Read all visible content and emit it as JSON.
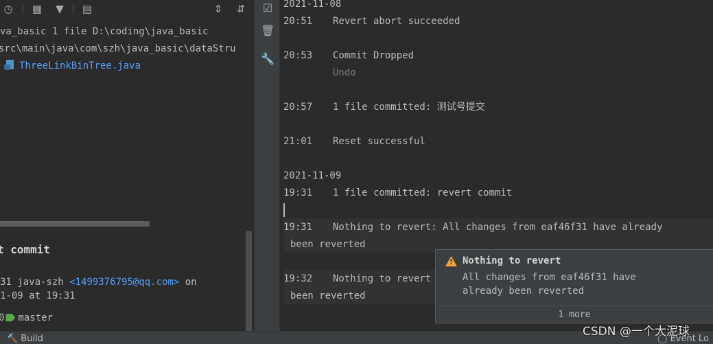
{
  "left_panel": {
    "toolbar_icons": [
      "history-icon",
      "group-by-icon",
      "filter-icon",
      "layout-icon",
      "expand-all-icon",
      "collapse-all-icon"
    ],
    "tree": {
      "root_row": "va_basic  1 file  D:\\coding\\java_basic",
      "path_row": "src\\main\\java\\com\\szh\\java_basic\\dataStru",
      "file_name": "ThreeLinkBinTree.java"
    },
    "commit": {
      "title": "t commit",
      "author_prefix": "31 java-szh ",
      "email": "<1499376795@qq.com>",
      "author_suffix": " on",
      "date": "1-09 at 19:31",
      "branch_prefix": "0",
      "branch": "master"
    }
  },
  "side_toolbar": {
    "icons": [
      "mark-all-read-icon",
      "clear-all-icon",
      "settings-wrench-icon"
    ]
  },
  "event_log": {
    "entries": [
      {
        "date": "2021-11-08"
      },
      {
        "time": "20:51",
        "message": "Revert abort succeeded"
      },
      {
        "time": "20:53",
        "message": "Commit Dropped",
        "link": "Undo"
      },
      {
        "time": "20:57",
        "message": "1 file committed: 测试号提交"
      },
      {
        "time": "21:01",
        "message": "Reset successful"
      },
      {
        "date": "2021-11-09"
      },
      {
        "time": "19:31",
        "message": "1 file committed: revert commit"
      },
      {
        "time": "19:31",
        "message": "Nothing to revert: All changes from eaf46f31 have already",
        "continuation": "been reverted"
      },
      {
        "time": "19:32",
        "message": "Nothing to revert",
        "continuation": "been reverted"
      }
    ]
  },
  "notification": {
    "title": "Nothing to revert",
    "body": "All changes from eaf46f31 have\nalready been reverted",
    "more": "1 more",
    "icon": "warning-icon",
    "accent": "#f0a732"
  },
  "bottom_bar": {
    "build_label": "Build",
    "event_log_label": "Event Lo"
  },
  "watermark": "CSDN @一个大泥球",
  "colors": {
    "background": "#2b2b2b",
    "toolbar": "#3c3f41",
    "link": "#589df6",
    "branch_tag": "#58a64b"
  }
}
